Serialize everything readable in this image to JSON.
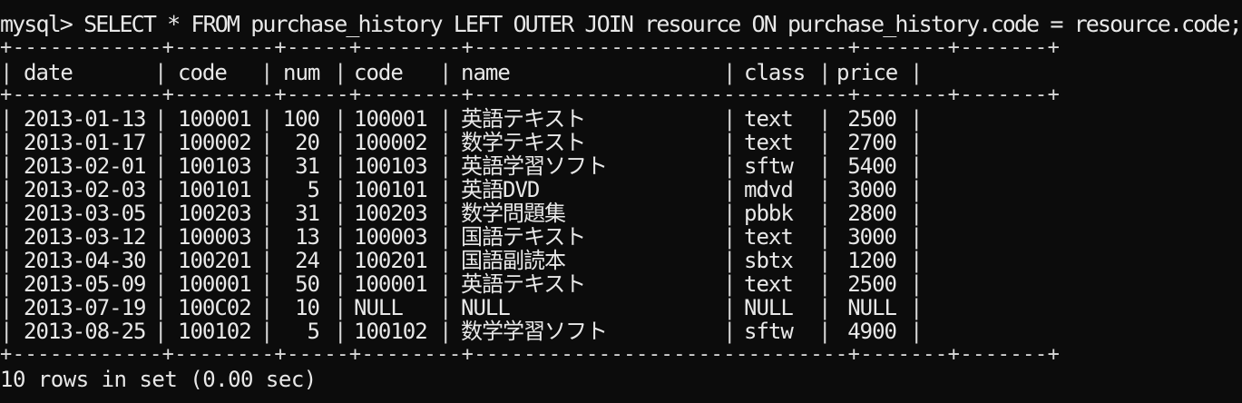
{
  "prompt": "mysql>",
  "query": " SELECT * FROM purchase_history LEFT OUTER JOIN resource ON purchase_history.code = resource.code;",
  "table": {
    "border_line": "+------------+--------+-----+--------+------------------------------+-------+-------+",
    "columns": [
      "date",
      "code",
      "num",
      "code",
      "name",
      "class",
      "price"
    ],
    "rows": [
      [
        "2013-01-13",
        "100001",
        "100",
        "100001",
        "英語テキスト",
        "text",
        "2500"
      ],
      [
        "2013-01-17",
        "100002",
        "20",
        "100002",
        "数学テキスト",
        "text",
        "2700"
      ],
      [
        "2013-02-01",
        "100103",
        "31",
        "100103",
        "英語学習ソフト",
        "sftw",
        "5400"
      ],
      [
        "2013-02-03",
        "100101",
        "5",
        "100101",
        "英語DVD",
        "mdvd",
        "3000"
      ],
      [
        "2013-03-05",
        "100203",
        "31",
        "100203",
        "数学問題集",
        "pbbk",
        "2800"
      ],
      [
        "2013-03-12",
        "100003",
        "13",
        "100003",
        "国語テキスト",
        "text",
        "3000"
      ],
      [
        "2013-04-30",
        "100201",
        "24",
        "100201",
        "国語副読本",
        "sbtx",
        "1200"
      ],
      [
        "2013-05-09",
        "100001",
        "50",
        "100001",
        "英語テキスト",
        "text",
        "2500"
      ],
      [
        "2013-07-19",
        "100C02",
        "10",
        "NULL",
        "NULL",
        "NULL",
        "NULL"
      ],
      [
        "2013-08-25",
        "100102",
        "5",
        "100102",
        "数学学習ソフト",
        "sftw",
        "4900"
      ]
    ]
  },
  "status": "10 rows in set (0.00 sec)",
  "colors": {
    "background": "#0c0c0c",
    "text": "#e8e8e8"
  }
}
